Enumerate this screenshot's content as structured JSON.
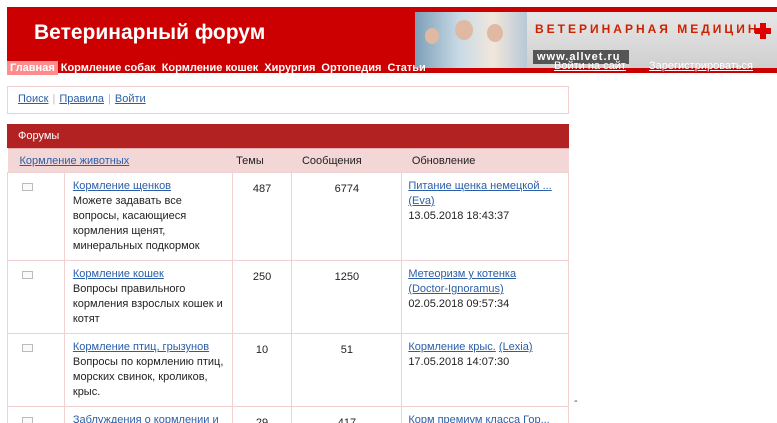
{
  "header": {
    "title": "Ветеринарный форум",
    "banner_text": "ВЕТЕРИНАРНАЯ МЕДИЦИНА",
    "banner_url": "www.allvet.ru",
    "brand_color": "#cc0000"
  },
  "nav": [
    "Главная",
    "Кормление собак",
    "Кормление кошек",
    "Хирургия",
    "Ортопедия",
    "Статьи"
  ],
  "auth": {
    "login": "Войти на сайт",
    "register": "Зарегистрироваться"
  },
  "toolbar": {
    "search": "Поиск",
    "rules": "Правила",
    "login": "Войти"
  },
  "forum": {
    "heading": "Форумы",
    "category": "Кормление животных",
    "columns": {
      "topics": "Темы",
      "posts": "Сообщения",
      "update": "Обновление"
    },
    "rows": [
      {
        "name": "Кормление щенков",
        "desc": "Можете задавать все вопросы, касающиеся кормления щенят, минеральных подкормок",
        "topics": "487",
        "posts": "6774",
        "last": "Питание щенка немецкой ...",
        "author": "(Eva)",
        "date": "13.05.2018 18:43:37"
      },
      {
        "name": "Кормление кошек",
        "desc": "Вопросы правильного кормления взрослых кошек и котят",
        "topics": "250",
        "posts": "1250",
        "last": "Метеоризм у котенка",
        "author": "(Doctor-Ignoramus)",
        "date": "02.05.2018 09:57:34"
      },
      {
        "name": "Кормление птиц, грызунов",
        "desc": "Вопросы по кормлению птиц, морских свинок, кроликов, крыс.",
        "topics": "10",
        "posts": "51",
        "last": "Кормление крыс.",
        "author": "(Lexia)",
        "date": "17.05.2018 14:07:30"
      },
      {
        "name": "Заблуждения о кормлении и",
        "desc": "",
        "topics": "29",
        "posts": "417",
        "last": "Корм премиум класса Гор...",
        "author": "",
        "date": ""
      }
    ]
  },
  "stray_mark": "-"
}
